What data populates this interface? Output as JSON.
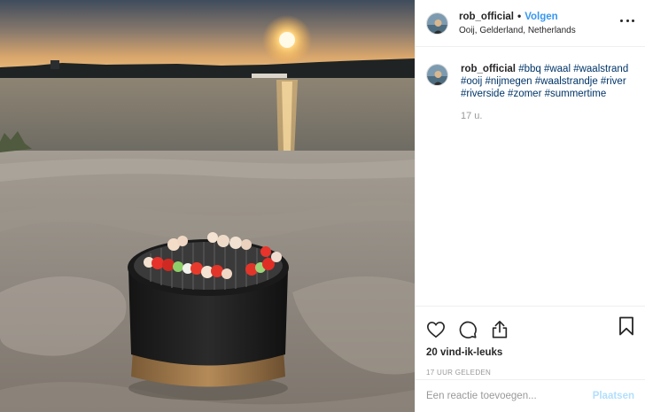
{
  "header": {
    "username": "rob_official",
    "separator": "•",
    "follow_label": "Volgen",
    "location": "Ooij, Gelderland, Netherlands"
  },
  "caption": {
    "username": "rob_official",
    "hashtags": "#bbq #waal #waalstrand #ooij #nijmegen #waalstrandje #river #riverside #zomer #summertime",
    "time": "17 u."
  },
  "actions": {
    "icons": [
      "heart-icon",
      "comment-icon",
      "share-icon",
      "bookmark-icon"
    ],
    "likes": "20 vind-ik-leuks",
    "timestamp": "17 UUR GELEDEN"
  },
  "comment_box": {
    "placeholder": "Een reactie toevoegen...",
    "post_label": "Plaatsen"
  },
  "colors": {
    "link": "#3897f0",
    "hashtag": "#003569",
    "muted": "#999999",
    "post_disabled": "#b2dffc"
  }
}
